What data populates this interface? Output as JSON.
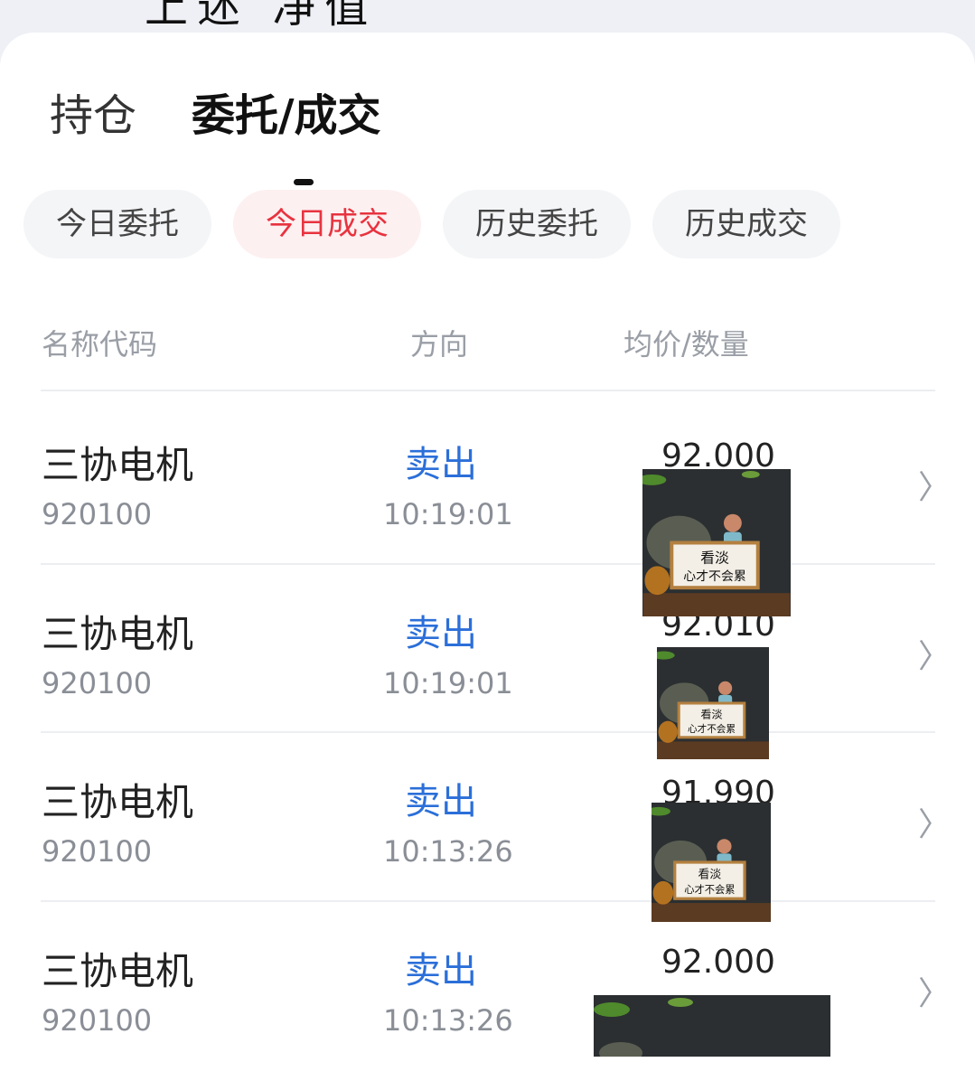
{
  "header": {
    "clipped_title": "上述 净值"
  },
  "tabs": [
    {
      "label": "持仓"
    },
    {
      "label": "委托/成交"
    }
  ],
  "filters": [
    {
      "label": "今日委托",
      "active": false
    },
    {
      "label": "今日成交",
      "active": true
    },
    {
      "label": "历史委托",
      "active": false
    },
    {
      "label": "历史成交",
      "active": false
    }
  ],
  "columns": {
    "name_code": "名称代码",
    "direction": "方向",
    "avg_qty": "均价/数量"
  },
  "rows": [
    {
      "name": "三协电机",
      "code": "920100",
      "direction": "卖出",
      "time": "10:19:01",
      "price": "92.000"
    },
    {
      "name": "三协电机",
      "code": "920100",
      "direction": "卖出",
      "time": "10:19:01",
      "price": "92.010"
    },
    {
      "name": "三协电机",
      "code": "920100",
      "direction": "卖出",
      "time": "10:13:26",
      "price": "91.990"
    },
    {
      "name": "三协电机",
      "code": "920100",
      "direction": "卖出",
      "time": "10:13:26",
      "price": "92.000"
    }
  ],
  "photo_caption": {
    "line1": "看淡",
    "line2": "心才不会累"
  },
  "icons": {
    "row_chevron": "chevron-right-icon"
  },
  "colors": {
    "active_red": "#e8333f",
    "sell_blue": "#2b6fd9"
  }
}
